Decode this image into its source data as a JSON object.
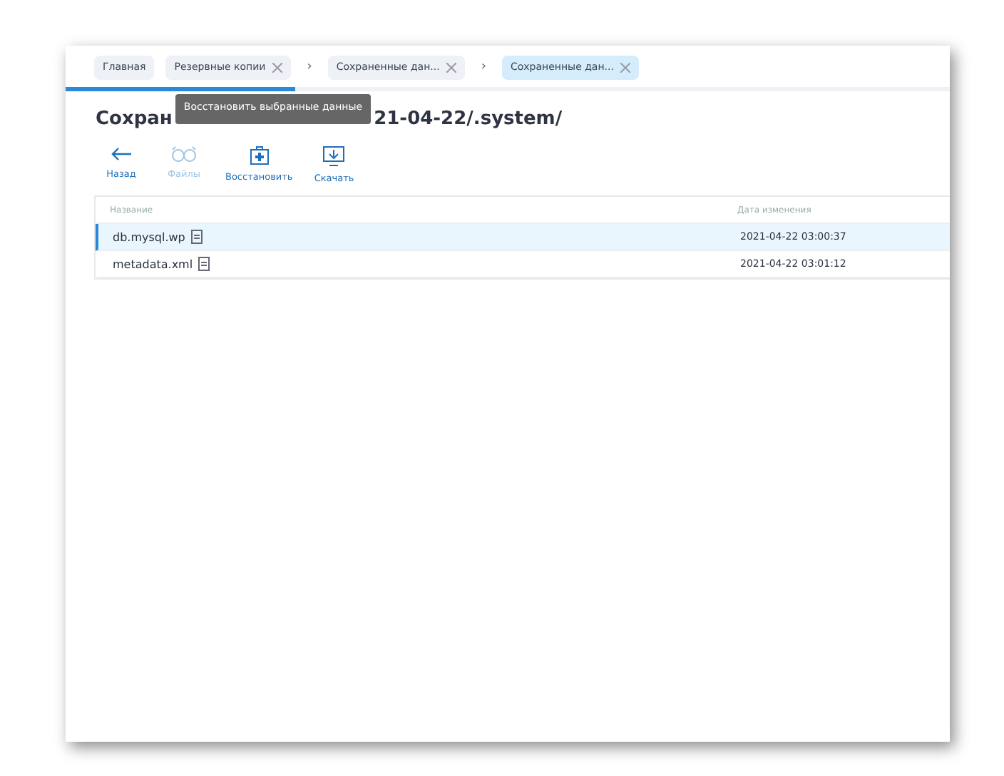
{
  "tabs": [
    {
      "label": "Главная",
      "closable": false,
      "selected": false
    },
    {
      "label": "Резервные копии",
      "closable": true,
      "selected": false
    },
    {
      "separator_before": "›",
      "label": "Сохраненные дан...",
      "closable": true,
      "selected": false
    },
    {
      "separator_before": "›",
      "label": "Сохраненные дан...",
      "closable": true,
      "selected": true
    }
  ],
  "loading": {
    "level": 0.26
  },
  "title": {
    "visible_start": "Сохран",
    "visible_end": "21-04-22/.system/"
  },
  "tooltip": "Восстановить выбранные данные",
  "toolbar": [
    {
      "kind": "back",
      "label": "Назад",
      "disabled": false
    },
    {
      "kind": "files",
      "label": "Файлы",
      "disabled": true
    },
    {
      "kind": "restore",
      "label": "Восстановить",
      "disabled": false
    },
    {
      "kind": "download",
      "label": "Скачать",
      "disabled": false
    }
  ],
  "table": {
    "columns": [
      "Название",
      "Дата изменения"
    ],
    "rows": [
      {
        "name": "db.mysql.wp",
        "date": "2021-04-22 03:00:37",
        "selected": true
      },
      {
        "name": "metadata.xml",
        "date": "2021-04-22 03:01:12",
        "selected": false
      }
    ]
  }
}
